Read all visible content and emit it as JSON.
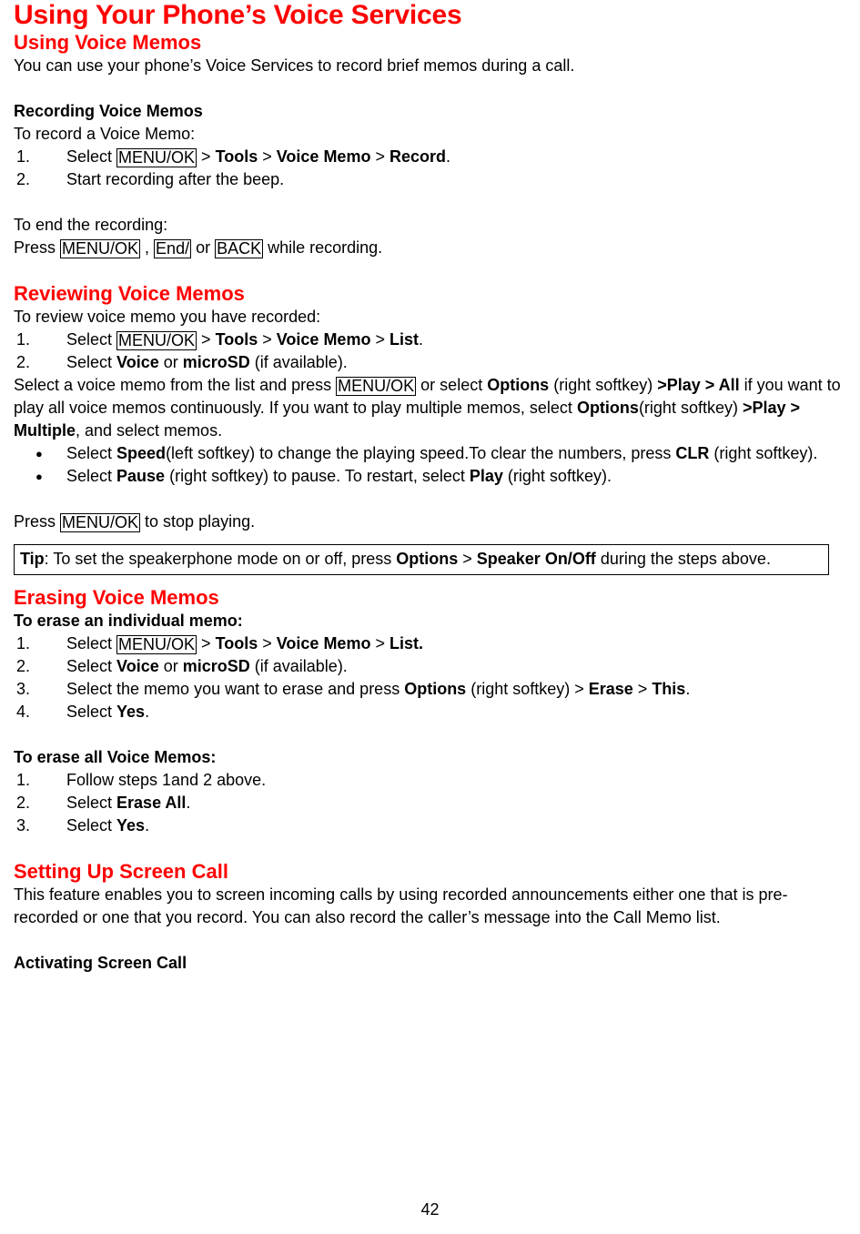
{
  "document": {
    "title": "Using Your Phone’s Voice Services",
    "page_number": "42"
  },
  "sections": {
    "using_voice_memos": {
      "heading": "Using Voice Memos",
      "intro": "You can use your phone’s Voice Services to record brief memos during a call."
    },
    "recording": {
      "heading": "Recording Voice Memos",
      "lead": "To record a Voice Memo:",
      "steps": [
        {
          "num": "1.",
          "pre": "Select ",
          "key": "MENU/OK",
          "post_1": " > ",
          "bold_1": "Tools",
          "post_2": " > ",
          "bold_2": "Voice Memo",
          "post_3": " > ",
          "bold_3": "Record",
          "post_4": "."
        },
        {
          "num": "2.",
          "text": "Start recording after the beep."
        }
      ],
      "end_lead": "To end the recording:",
      "end_line": {
        "pre": "Press ",
        "key_1": "MENU/OK",
        "mid_1": " , ",
        "key_2": "End/",
        "mid_2": " or ",
        "key_3": "BACK",
        "post": " while recording."
      }
    },
    "reviewing": {
      "heading": "Reviewing Voice Memos",
      "lead": "To review voice memo you have recorded:",
      "steps": [
        {
          "num": "1.",
          "pre": "Select ",
          "key": "MENU/OK",
          "post_1": " > ",
          "bold_1": "Tools",
          "post_2": " > ",
          "bold_2": "Voice Memo",
          "post_3": " > ",
          "bold_3": "List",
          "post_4": "."
        },
        {
          "num": "2.",
          "pre": "Select ",
          "bold_1": "Voice",
          "mid": " or ",
          "bold_2": "microSD",
          "post": " (if available)."
        }
      ],
      "paragraph": {
        "t1": "Select a voice memo from the list and press ",
        "key": "MENU/OK",
        "t2": " or select ",
        "b1": "Options",
        "t3": " (right softkey) ",
        "b2": ">Play > All",
        "t4": " if you want to play all voice memos continuously. If you want to play multiple memos, select ",
        "b3": "Options",
        "t5": "(right softkey) ",
        "b4": ">Play > Multiple",
        "t6": ", and select memos."
      },
      "bullets": [
        {
          "t1": "Select ",
          "b1": "Speed",
          "t2": "(left softkey) to change the playing speed.To clear the numbers, press ",
          "b2": "CLR",
          "t3": " (right softkey)."
        },
        {
          "t1": "Select ",
          "b1": "Pause",
          "t2": " (right softkey) to pause. To restart, select ",
          "b2": "Play",
          "t3": " (right softkey)."
        }
      ],
      "stop_line": {
        "pre": "Press ",
        "key": "MENU/OK",
        "post": " to stop playing."
      },
      "tip": {
        "label": "Tip",
        "t1": ": To set the speakerphone mode on or off, press ",
        "b1": "Options",
        "t2": " > ",
        "b2": "Speaker On/Off",
        "t3": " during the steps above."
      }
    },
    "erasing": {
      "heading": "Erasing Voice Memos",
      "individual": {
        "lead": "To erase an individual memo:",
        "steps": [
          {
            "num": "1.",
            "pre": "Select ",
            "key": "MENU/OK",
            "post_1": " > ",
            "bold_1": "Tools",
            "post_2": " > ",
            "bold_2": "Voice Memo",
            "post_3": " > ",
            "bold_3": "List.",
            "post_4": ""
          },
          {
            "num": "2.",
            "pre": "Select ",
            "bold_1": "Voice",
            "mid": " or ",
            "bold_2": "microSD",
            "post": " (if available)."
          },
          {
            "num": "3.",
            "t1": "Select the memo you want to erase and press ",
            "b1": "Options",
            "t2": " (right softkey) > ",
            "b2": "Erase",
            "t3": " > ",
            "b3": "This",
            "t4": "."
          },
          {
            "num": "4.",
            "t1": "Select ",
            "b1": "Yes",
            "t2": "."
          }
        ]
      },
      "all": {
        "lead": "To erase all Voice Memos:",
        "steps": [
          {
            "num": "1.",
            "t1": "Follow steps 1and 2 above.",
            "b1": "",
            "t2": ""
          },
          {
            "num": "2.",
            "t1": "Select ",
            "b1": "Erase All",
            "t2": "."
          },
          {
            "num": "3.",
            "t1": "Select ",
            "b1": "Yes",
            "t2": "."
          }
        ]
      }
    },
    "screen_call": {
      "heading": "Setting Up Screen Call",
      "paragraph": "This feature enables you to screen incoming calls by using recorded announcements either one that is pre-recorded or one that you record. You can also record the caller’s message into the Call Memo list.",
      "subheading": "Activating Screen Call"
    }
  },
  "colors": {
    "heading_red": "#FF0000",
    "text_black": "#000000",
    "page_background": "#FFFFFF"
  }
}
